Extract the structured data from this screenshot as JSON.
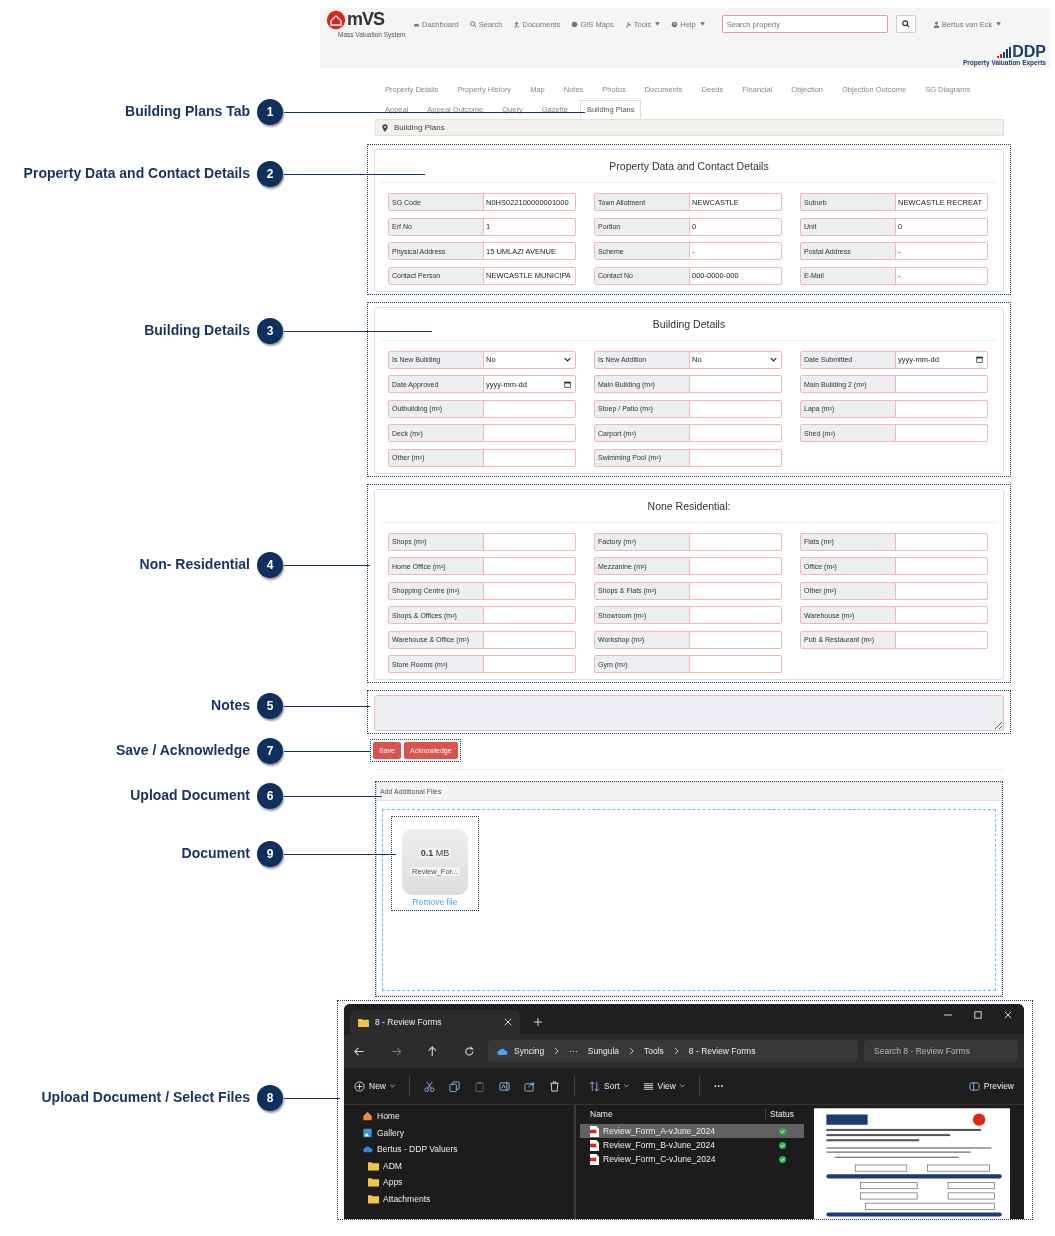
{
  "header": {
    "logo_text": "mVS",
    "logo_subtitle": "Mass Valuation System",
    "nav": [
      {
        "label": "Dashboard",
        "kind": "dashboard",
        "dropdown": false
      },
      {
        "label": "Search",
        "kind": "search",
        "dropdown": false
      },
      {
        "label": "Documents",
        "kind": "upload",
        "dropdown": false
      },
      {
        "label": "GIS Maps",
        "kind": "globe",
        "dropdown": false
      },
      {
        "label": "Tools",
        "kind": "wrench",
        "dropdown": true
      },
      {
        "label": "Help",
        "kind": "help",
        "dropdown": true
      }
    ],
    "search": {
      "placeholder": "Search property"
    },
    "user": "Bertus van Eck",
    "brand": "DDP",
    "brand_tagline": "Property Valuation Experts"
  },
  "tabs": [
    {
      "label": "Property Details",
      "selected": false
    },
    {
      "label": "Property History",
      "selected": false
    },
    {
      "label": "Map",
      "selected": false
    },
    {
      "label": "Notes",
      "selected": false
    },
    {
      "label": "Photos",
      "selected": false
    },
    {
      "label": "Documents",
      "selected": false
    },
    {
      "label": "Deeds",
      "selected": false
    },
    {
      "label": "Financial",
      "selected": false
    },
    {
      "label": "Objection",
      "selected": false
    },
    {
      "label": "Objection Outcome",
      "selected": false
    },
    {
      "label": "SG Diagrams",
      "selected": false
    },
    {
      "label": "Appeal",
      "selected": false
    },
    {
      "label": "Appeal Outcome",
      "selected": false
    },
    {
      "label": "Query",
      "selected": false
    },
    {
      "label": "Gazette",
      "selected": false
    },
    {
      "label": "Building Plans",
      "selected": true
    }
  ],
  "breadcrumb": "Building Plans",
  "sections": [
    {
      "title": "Property Data and Contact Details",
      "fields": [
        {
          "label": "SG Code",
          "kind": "text",
          "value": "N0HS022100000001000"
        },
        {
          "label": "Town Allotment",
          "kind": "text",
          "value": "NEWCASTLE"
        },
        {
          "label": "Suburb",
          "kind": "text",
          "value": "NEWCASTLE RECREAT"
        },
        {
          "label": "Erf No",
          "kind": "text",
          "value": "1"
        },
        {
          "label": "Portion",
          "kind": "text",
          "value": "0"
        },
        {
          "label": "Unit",
          "kind": "text",
          "value": "0"
        },
        {
          "label": "Physical Address",
          "kind": "text",
          "value": "15 UMLAZI AVENUE"
        },
        {
          "label": "Scheme",
          "kind": "text",
          "value": "-"
        },
        {
          "label": "Postal Address",
          "kind": "text",
          "value": "-"
        },
        {
          "label": "Contact Person",
          "kind": "text",
          "value": "NEWCASTLE MUNICIPA"
        },
        {
          "label": "Contact No",
          "kind": "text",
          "value": "000-0000-000"
        },
        {
          "label": "E-Mail",
          "kind": "text",
          "value": "-"
        }
      ]
    },
    {
      "title": "Building Details",
      "fields": [
        {
          "label": "Is New Building",
          "kind": "select",
          "value": "No"
        },
        {
          "label": "Is New Addition",
          "kind": "select",
          "value": "No"
        },
        {
          "label": "Date Submitted",
          "kind": "date",
          "placeholder": "yyyy-mm-dd"
        },
        {
          "label": "Date Approved",
          "kind": "date",
          "placeholder": "yyyy-mm-dd"
        },
        {
          "label": "Main Building (m²)",
          "kind": "text"
        },
        {
          "label": "Main Building 2 (m²)",
          "kind": "text"
        },
        {
          "label": "Outbuilding (m²)",
          "kind": "text"
        },
        {
          "label": "Stoep / Patio (m²)",
          "kind": "text"
        },
        {
          "label": "Lapa (m²)",
          "kind": "text"
        },
        {
          "label": "Deck (m²)",
          "kind": "text"
        },
        {
          "label": "Carport (m²)",
          "kind": "text"
        },
        {
          "label": "Shed (m²)",
          "kind": "text"
        },
        {
          "label": "Other (m²)",
          "kind": "text"
        },
        {
          "label": "Swimming Pool (m²)",
          "kind": "text"
        }
      ]
    },
    {
      "title": "None Residential:",
      "fields": [
        {
          "label": "Shops (m²)",
          "kind": "text"
        },
        {
          "label": "Factory (m²)",
          "kind": "text"
        },
        {
          "label": "Flats (m²)",
          "kind": "text"
        },
        {
          "label": "Home Office (m²)",
          "kind": "text"
        },
        {
          "label": "Mezzanine (m²)",
          "kind": "text"
        },
        {
          "label": "Office (m²)",
          "kind": "text"
        },
        {
          "label": "Shopping Centre (m²)",
          "kind": "text"
        },
        {
          "label": "Shops & Flats (m²)",
          "kind": "text"
        },
        {
          "label": "Other (m²)",
          "kind": "text"
        },
        {
          "label": "Shops & Offices (m²)",
          "kind": "text"
        },
        {
          "label": "Showroom (m²)",
          "kind": "text"
        },
        {
          "label": "Warehouse (m²)",
          "kind": "text"
        },
        {
          "label": "Warehouse & Office (m²)",
          "kind": "text"
        },
        {
          "label": "Workshop (m²)",
          "kind": "text"
        },
        {
          "label": "Pub & Restaurant (m²)",
          "kind": "text"
        },
        {
          "label": "Store Rooms (m²)",
          "kind": "text"
        },
        {
          "label": "Gym (m²)",
          "kind": "text"
        }
      ]
    }
  ],
  "buttons": [
    "Save",
    "Acknowledge"
  ],
  "upload": {
    "title": "Add Additional Files",
    "files": [
      {
        "size": "**0.1** MB",
        "name": "Review_For...",
        "remove": "Remove file"
      }
    ]
  },
  "explorer": {
    "tab_title": "8 - Review Forms",
    "sync": "Syncing",
    "ellipsis": "···",
    "path": [
      "Sungula",
      "Tools",
      "8 - Review Forms"
    ],
    "search": {
      "placeholder": "Search 8 - Review Forms"
    },
    "toolbar": {
      "new": "New",
      "sort": "Sort",
      "view": "View",
      "more": "···",
      "preview": "Preview"
    },
    "sidebar": [
      {
        "label": "Home",
        "kind": "home"
      },
      {
        "label": "Gallery",
        "kind": "gallery"
      },
      {
        "label": "Bertus - DDP Valuers",
        "kind": "cloud"
      },
      {
        "label": "ADM",
        "kind": "folder"
      },
      {
        "label": "Apps",
        "kind": "folder"
      },
      {
        "label": "Attachments",
        "kind": "folder"
      }
    ],
    "columns": [
      "Name",
      "Status"
    ],
    "files": [
      {
        "name": "Review_Form_A-vJune_2024",
        "selected": true,
        "synced": true
      },
      {
        "name": "Review_Form_B-vJune_2024",
        "selected": false,
        "synced": true
      },
      {
        "name": "Review_Form_C-vJune_2024",
        "selected": false,
        "synced": true
      }
    ]
  },
  "callouts": [
    {
      "label": "Building Plans Tab",
      "number": "1"
    },
    {
      "label": "Property Data and Contact Details",
      "number": "2"
    },
    {
      "label": "Building Details",
      "number": "3"
    },
    {
      "label": "Non- Residential",
      "number": "4"
    },
    {
      "label": "Notes",
      "number": "5"
    },
    {
      "label": "Save / Acknowledge",
      "number": "7"
    },
    {
      "label": "Upload Document",
      "number": "6"
    },
    {
      "label": "Document",
      "number": "9"
    },
    {
      "label": "Upload Document / Select Files",
      "number": "8"
    }
  ]
}
